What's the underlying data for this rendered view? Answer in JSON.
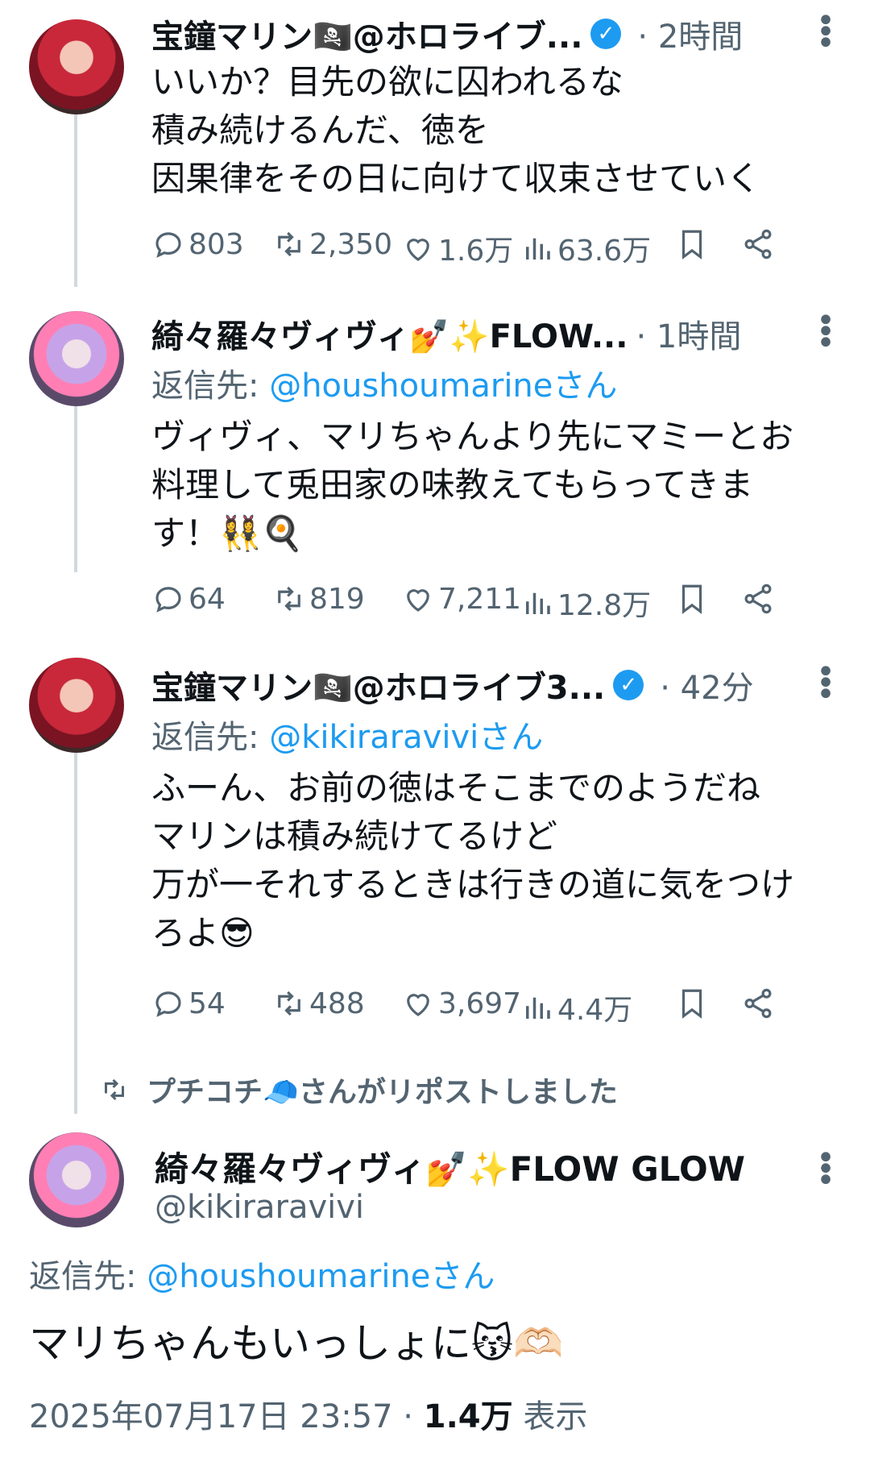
{
  "tweets": [
    {
      "name": "宝鐘マリン🏴‍☠️@ホロライブ...",
      "verified": true,
      "time": "2時間",
      "reply_prefix": "",
      "reply_handle": "",
      "text": "いいか？目先の欲に囚われるな\n積み続けるんだ、徳を\n因果律をその日に向けて収束させていく",
      "replies": "803",
      "reposts": "2,350",
      "likes": "1.6万",
      "views": "63.6万"
    },
    {
      "name": "綺々羅々ヴィヴィ💅✨FLOW...",
      "verified": false,
      "time": "1時間",
      "reply_prefix": "返信先: ",
      "reply_handle": "@houshoumarineさん",
      "text": "ヴィヴィ、マリちゃんより先にマミーとお\n料理して兎田家の味教えてもらってきま\nす！👯‍♀️🍳",
      "replies": "64",
      "reposts": "819",
      "likes": "7,211",
      "views": "12.8万"
    },
    {
      "name": "宝鐘マリン🏴‍☠️@ホロライブ3...",
      "verified": true,
      "time": "42分",
      "reply_prefix": "返信先: ",
      "reply_handle": "@kikiraraviviさん",
      "text": "ふーん、お前の徳はそこまでのようだね\nマリンは積み続けてるけど\n万が一それするときは行きの道に気をつけ\nろよ😎",
      "replies": "54",
      "reposts": "488",
      "likes": "3,697",
      "views": "4.4万"
    }
  ],
  "repost_banner": "プチコチ🧢さんがリポストしました",
  "main": {
    "name": "綺々羅々ヴィヴィ💅✨FLOW GLOW",
    "handle": "@kikiraravivi",
    "reply_prefix": "返信先: ",
    "reply_handle": "@houshoumarineさん",
    "text": "マリちゃんもいっしょに😽🫶🏻",
    "datetime": "2025年07月17日 23:57",
    "sep": " · ",
    "views": "1.4万",
    "views_label": " 表示"
  },
  "icons": {
    "reply": "reply-icon",
    "repost": "repost-icon",
    "like": "heart-icon",
    "views": "views-chart-icon",
    "bookmark": "bookmark-icon",
    "share": "share-icon",
    "more": "more-vertical-icon",
    "verified": "verified-badge-icon"
  },
  "colors": {
    "link": "#1d9bf0",
    "secondary": "#536471",
    "text": "#0f1419"
  }
}
